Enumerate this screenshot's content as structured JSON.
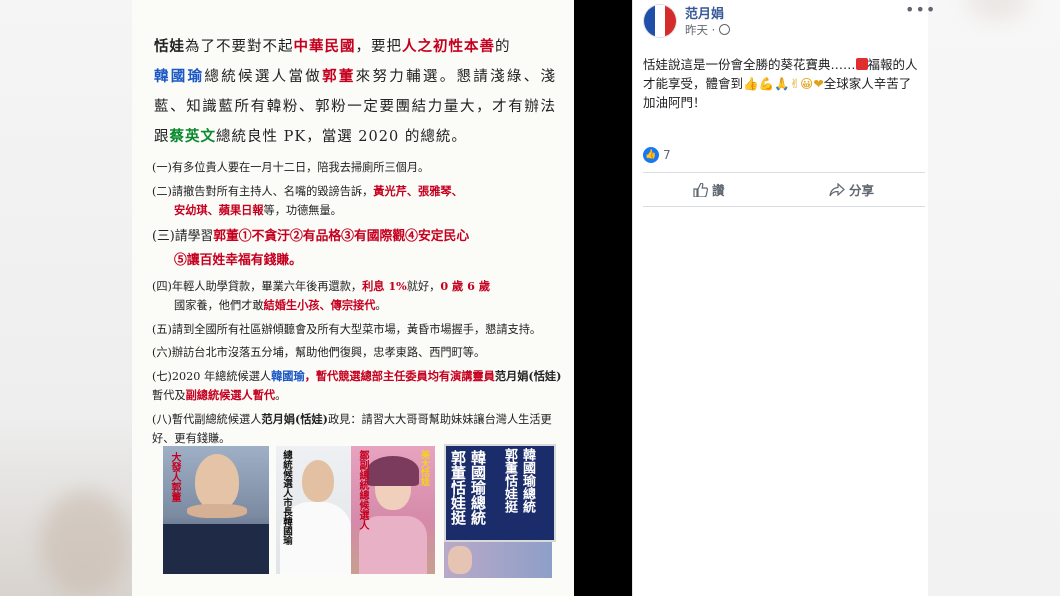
{
  "poster": {
    "head_line1_a": "恬娃",
    "head_line1_b": "為了不要對不起",
    "head_line1_c": "中華民國",
    "head_line1_d": "，要把",
    "head_line1_e": "人之初性本善",
    "head_line1_f": "的",
    "head_line2_a": "韓國瑜",
    "head_line2_b": "總統候選人當做",
    "head_line2_c": "郭董",
    "head_line2_d": "來努力輔選。懇請淺綠、淺藍、知識藍所有韓粉、郭粉一定要團結力量大，才有辦法跟",
    "head_line2_e": "蔡英文",
    "head_line2_f": "總統良性 PK，當選 2020 的總統。",
    "item1": "(一)有多位貴人要在一月十二日，陪我去掃廁所三個月。",
    "item2_a": "(二)請撤告對所有主持人、名嘴的毀謗告訴，",
    "item2_b": "黃光芹、張雅琴、",
    "item2_c": "安幼琪、蘋果日報",
    "item2_d": "等，功德無量。",
    "item3_a": "(三)請學習",
    "item3_b": "郭董",
    "item3_c": "①不貪汙②有品格③有國際觀④安定民心",
    "item3_d": "⑤讓百姓幸福有錢賺。",
    "item4_a": "(四)年輕人助學貸款，畢業六年後再還款，",
    "item4_b": "利息 1%",
    "item4_c": "就好，",
    "item4_d": "0 歲 6 歲",
    "item4_e": "國家養，他們才敢",
    "item4_f": "結婚生小孩、傳宗接代",
    "item4_g": "。",
    "item5": "(五)請到全國所有社區辦傾聽會及所有大型菜市場，黃昏市場握手，懇請支持。",
    "item6": "(六)辦訪台北市沒落五分埔，幫助他們復興，忠孝東路、西門町等。",
    "item7_a": "(七)2020 年總統候選人",
    "item7_b": "韓國瑜",
    "item7_c": "，暫代競選總部主任委員均有演講靈員",
    "item7_d": "范月娟(恬娃)",
    "item7_e": "暫代及",
    "item7_f": "副總統候選人暫代",
    "item7_g": "。",
    "item8_a": "(八)暫代副總統候選人",
    "item8_b": "范月娟(恬娃)",
    "item8_c": "政見：請習大大哥哥幫助妹妹讓台灣人生活更好、更有錢賺。",
    "photo1_label": "大發人郭董",
    "photo2_label": "總統候選人市長韓國瑜",
    "photo3_label": "鄒副總統總候選人",
    "photo3_tag": "美大恬娃",
    "photo4_col1": "郭董恬娃挺",
    "photo4_col2": "韓國瑜總統",
    "photo4_col3": "郭董恬娃挺",
    "photo4_col4": "韓國瑜總統"
  },
  "post": {
    "author": "范月娟",
    "time": "昨天 · ",
    "text_a": "恬娃說這是一份會全勝的葵花寶典……",
    "text_b": "福報的人才能享受，體會到",
    "emoji": "👍💪🙏✌😀❤",
    "text_c": "全球家人辛苦了加油阿門！",
    "like_count": "7",
    "like_label": "讚",
    "share_label": "分享",
    "more_icon": "•••"
  },
  "colors": {
    "accent_red": "#c5001f",
    "green": "#0a8a2d",
    "fb_blue": "#1877f2",
    "link_blue": "#385898"
  }
}
